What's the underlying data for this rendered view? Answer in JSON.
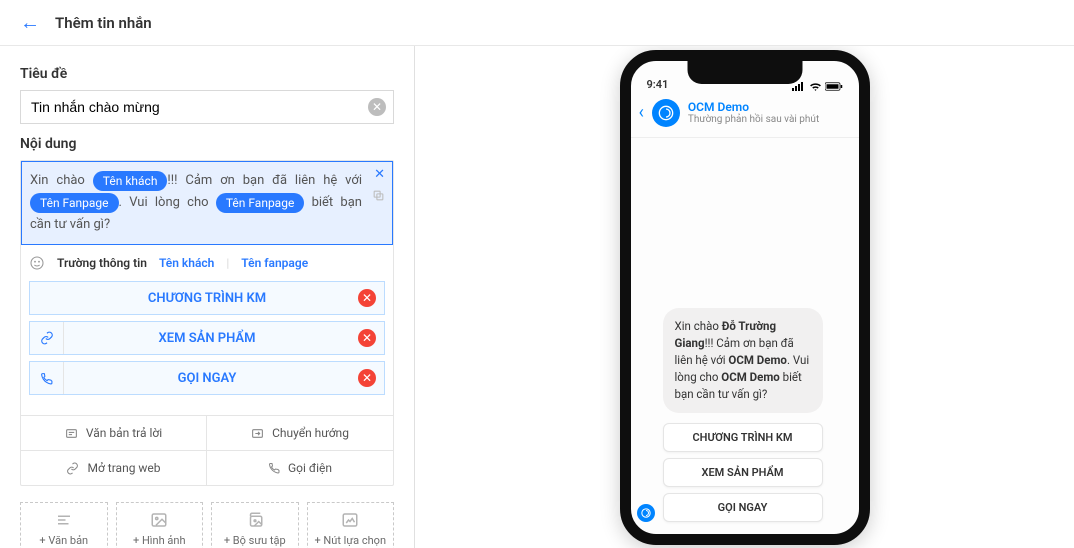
{
  "header": {
    "title": "Thêm tin nhắn"
  },
  "form": {
    "title_label": "Tiêu đề",
    "title_value": "Tin nhắn chào mừng",
    "content_label": "Nội dung",
    "editor": {
      "pre1": "Xin chào",
      "token1": "Tên khách",
      "mid1": "!!! Cảm ơn bạn đã liên hệ với",
      "token2": "Tên Fanpage",
      "mid2": ". Vui lòng cho",
      "token3": "Tên Fanpage",
      "post": "biết bạn cần tư vấn gì?"
    },
    "insert": {
      "label": "Trường thông tin",
      "opt1": "Tên khách",
      "opt2": "Tên fanpage"
    },
    "actions": [
      {
        "icon": "",
        "label": "CHƯƠNG TRÌNH KM"
      },
      {
        "icon": "link",
        "label": "XEM SẢN PHẨM"
      },
      {
        "icon": "phone",
        "label": "GỌI NGAY"
      }
    ],
    "tools": {
      "reply": "Văn bản trả lời",
      "redirect": "Chuyển hướng",
      "openweb": "Mở trang web",
      "call": "Gọi điện"
    },
    "addRow": {
      "text": "+ Văn bản",
      "image": "+ Hình ảnh",
      "collection": "+ Bộ sưu tập",
      "options": "+ Nút lựa chọn"
    }
  },
  "phone": {
    "time": "9:41",
    "page_name": "OCM Demo",
    "response_sub": "Thường phản hồi sau vài phút",
    "msg_pre": "Xin chào ",
    "msg_name": "Đỗ Trường Giang",
    "msg_mid1": "!!! Cảm ơn bạn đã liên hệ với ",
    "msg_brand1": "OCM Demo",
    "msg_mid2": ". Vui lòng cho ",
    "msg_brand2": "OCM Demo",
    "msg_post": " biết bạn cần tư vấn gì?",
    "qr1": "CHƯƠNG TRÌNH KM",
    "qr2": "XEM SẢN PHẨM",
    "qr3": "GỌI NGAY"
  }
}
